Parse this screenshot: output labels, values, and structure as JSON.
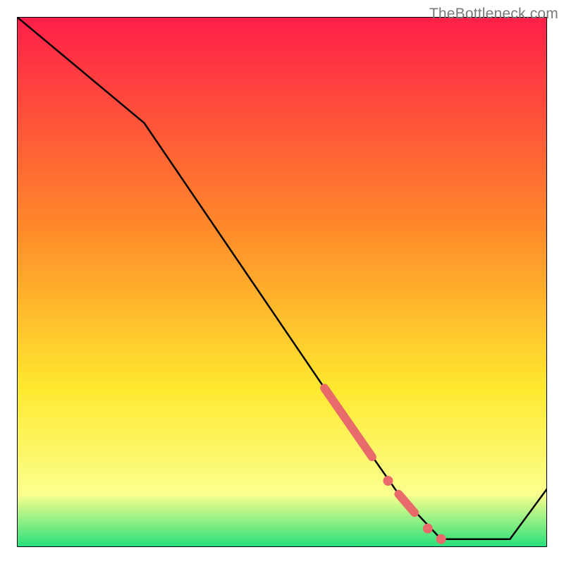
{
  "attribution": "TheBottleneck.com",
  "colors": {
    "gradient_top": "#ff1f49",
    "gradient_orange": "#ff8a2a",
    "gradient_yellow": "#ffe92f",
    "gradient_lightyellow": "#fbff8e",
    "gradient_green": "#27e07a",
    "marker": "#e86a6a",
    "line": "#000000",
    "border": "#000000"
  },
  "chart_data": {
    "type": "line",
    "title": "",
    "xlabel": "",
    "ylabel": "",
    "xlim": [
      0,
      100
    ],
    "ylim": [
      0,
      100
    ],
    "series": [
      {
        "name": "curve",
        "points": [
          {
            "x": 0,
            "y": 100
          },
          {
            "x": 24,
            "y": 80
          },
          {
            "x": 58,
            "y": 30
          },
          {
            "x": 72,
            "y": 10
          },
          {
            "x": 80,
            "y": 1.5
          },
          {
            "x": 93,
            "y": 1.5
          },
          {
            "x": 100,
            "y": 11
          }
        ]
      }
    ],
    "markers": [
      {
        "type": "segment",
        "x1": 58,
        "y1": 30,
        "x2": 67,
        "y2": 17,
        "thick": true
      },
      {
        "type": "dot",
        "x": 70,
        "y": 12.5
      },
      {
        "type": "segment",
        "x1": 72,
        "y1": 10,
        "x2": 75,
        "y2": 6.5,
        "thick": true
      },
      {
        "type": "dot",
        "x": 77.5,
        "y": 3.5
      },
      {
        "type": "dot",
        "x": 80,
        "y": 1.5
      }
    ]
  }
}
